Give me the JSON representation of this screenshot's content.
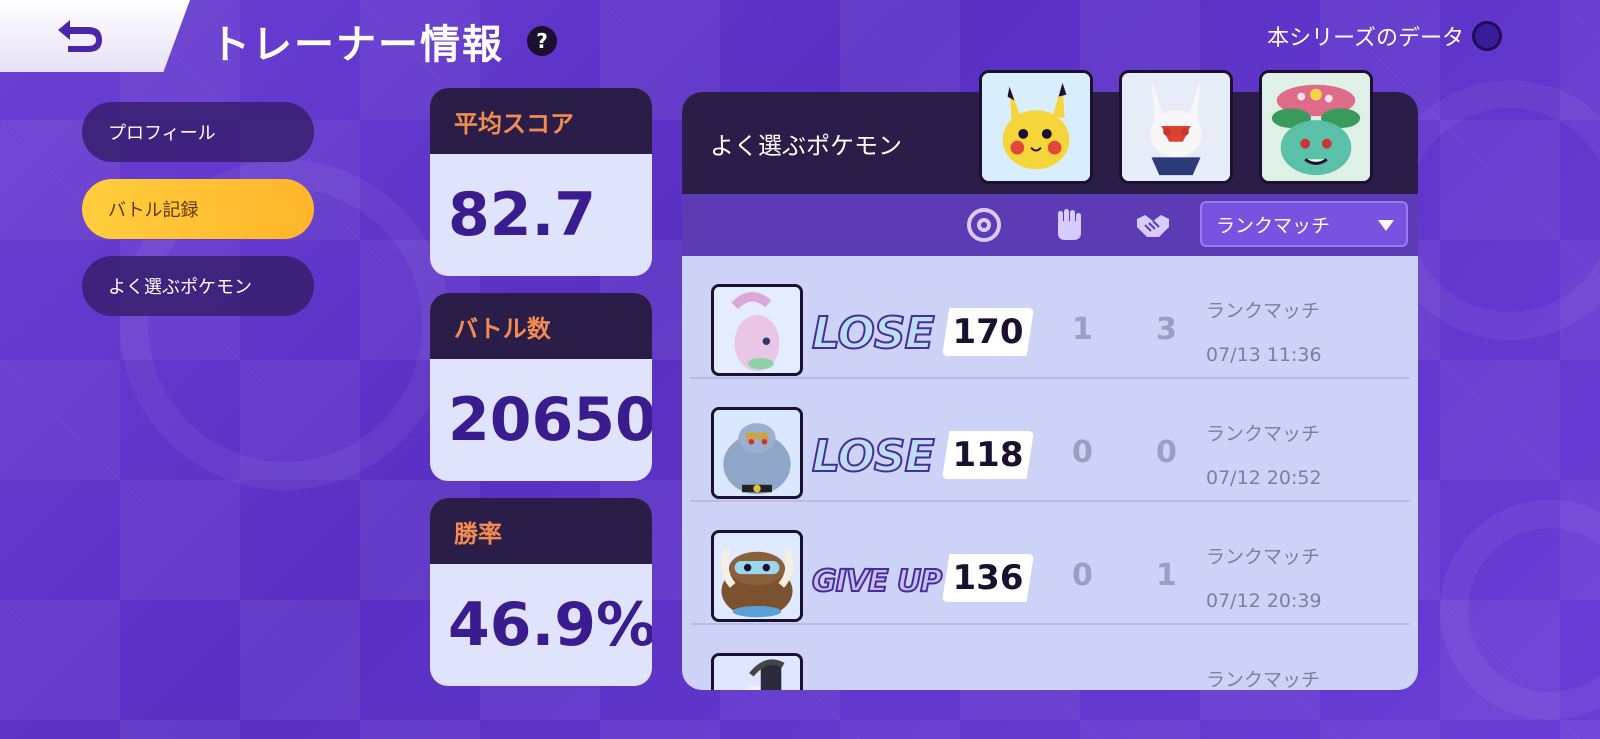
{
  "header": {
    "title": "トレーナー情報",
    "help": "?",
    "season_label": "本シリーズのデータ"
  },
  "sidebar": {
    "items": [
      {
        "label": "プロフィール",
        "active": false
      },
      {
        "label": "バトル記録",
        "active": true
      },
      {
        "label": "よく選ぶポケモン",
        "active": false
      }
    ]
  },
  "stats": {
    "avg_score_label": "平均スコア",
    "avg_score_value": "82.7",
    "battles_label": "バトル数",
    "battles_value": "20650",
    "winrate_label": "勝率",
    "winrate_value": "46.9%"
  },
  "panel": {
    "favorite_label": "よく選ぶポケモン",
    "favorites": [
      "pikachu-portrait",
      "cinderace-portrait",
      "venusaur-portrait"
    ],
    "filter": {
      "icons": [
        "score-icon",
        "ko-fist-icon",
        "assist-handshake-icon"
      ],
      "selected": "ランクマッチ"
    }
  },
  "records": [
    {
      "pokemon": "goodra",
      "result": "LOSE",
      "score": "170",
      "kos": "1",
      "assists": "3",
      "mode": "ランクマッチ",
      "date": "07/13 11:36"
    },
    {
      "pokemon": "machamp",
      "result": "LOSE",
      "score": "118",
      "kos": "0",
      "assists": "0",
      "mode": "ランクマッチ",
      "date": "07/12 20:52"
    },
    {
      "pokemon": "mamoswine",
      "result": "GIVE UP",
      "score": "136",
      "kos": "0",
      "assists": "1",
      "mode": "ランクマッチ",
      "date": "07/12 20:39"
    },
    {
      "pokemon": "absol",
      "result": "",
      "score": "",
      "kos": "",
      "assists": "",
      "mode": "ランクマッチ",
      "date": ""
    }
  ],
  "colors": {
    "background": "#6b3fd4",
    "accent_orange": "#f08c50",
    "active_tab": "#ffce3d",
    "card_header": "#2a1d48",
    "value_text": "#3a1c8e"
  }
}
